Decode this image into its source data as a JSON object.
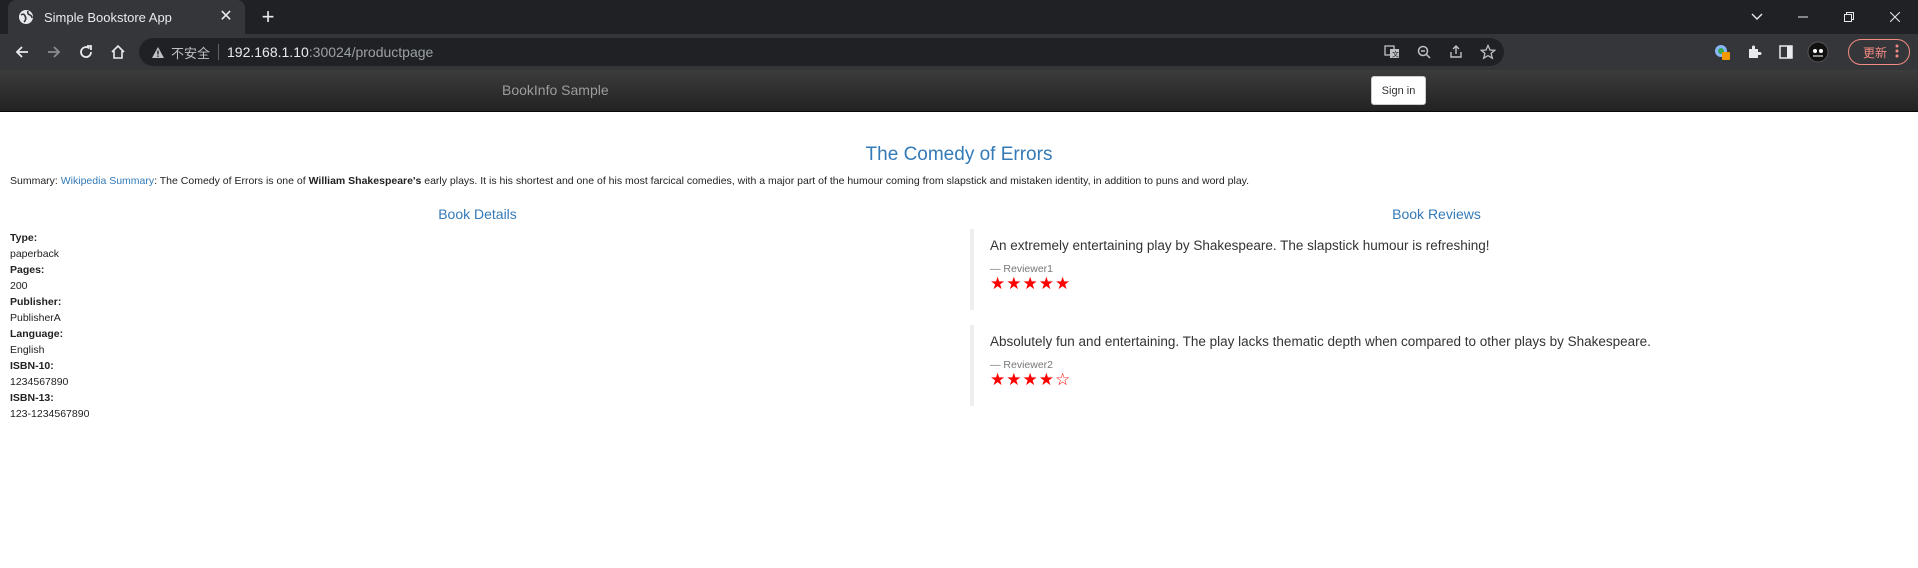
{
  "browser": {
    "tab_title": "Simple Bookstore App",
    "insecure_label": "不安全",
    "url_host": "192.168.1.10",
    "url_path": ":30024/productpage",
    "update_label": "更新"
  },
  "navbar": {
    "brand": "BookInfo Sample",
    "signin_label": "Sign in"
  },
  "product": {
    "title": "The Comedy of Errors",
    "summary_prefix": "Summary: ",
    "summary_link": "Wikipedia Summary",
    "summary_text1": ": The Comedy of Errors is one of ",
    "summary_bold": "William Shakespeare's",
    "summary_text2": " early plays. It is his shortest and one of his most farcical comedies, with a major part of the humour coming from slapstick and mistaken identity, in addition to puns and word play."
  },
  "details": {
    "heading": "Book Details",
    "items": [
      {
        "label": "Type:",
        "value": "paperback"
      },
      {
        "label": "Pages:",
        "value": "200"
      },
      {
        "label": "Publisher:",
        "value": "PublisherA"
      },
      {
        "label": "Language:",
        "value": "English"
      },
      {
        "label": "ISBN-10:",
        "value": "1234567890"
      },
      {
        "label": "ISBN-13:",
        "value": "123-1234567890"
      }
    ]
  },
  "reviews": {
    "heading": "Book Reviews",
    "items": [
      {
        "text": "An extremely entertaining play by Shakespeare. The slapstick humour is refreshing!",
        "reviewer": "— Reviewer1",
        "stars": "★★★★★",
        "rating": 5
      },
      {
        "text": "Absolutely fun and entertaining. The play lacks thematic depth when compared to other plays by Shakespeare.",
        "reviewer": "— Reviewer2",
        "stars": "★★★★☆",
        "rating": 4
      }
    ],
    "star_color": "#ff0000"
  }
}
